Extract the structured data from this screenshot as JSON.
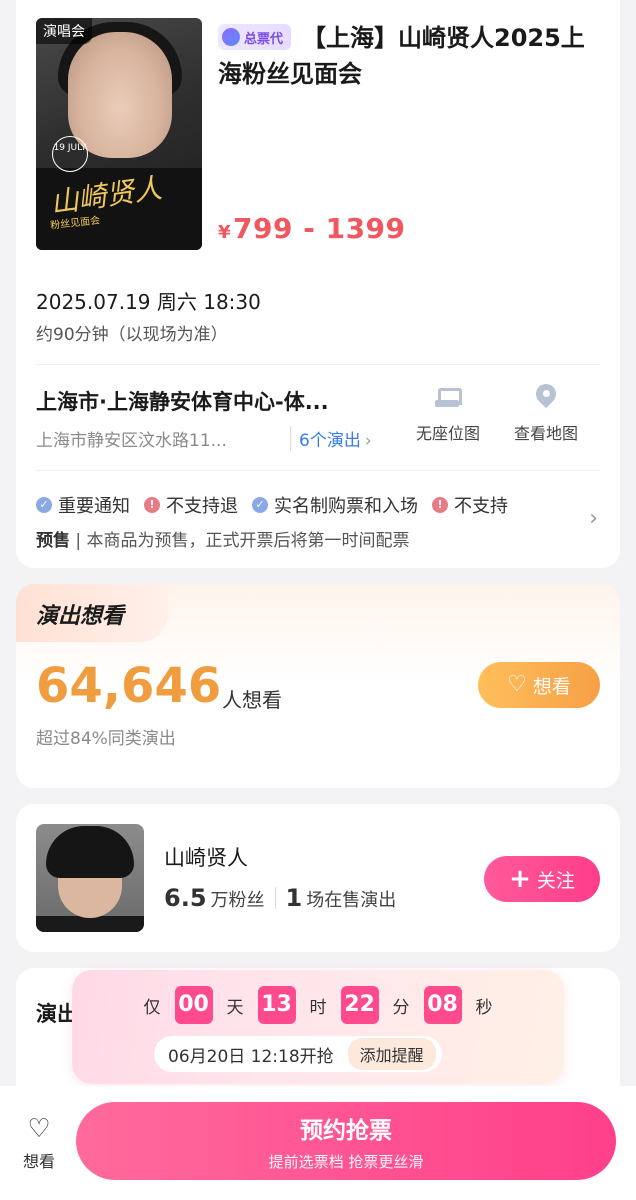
{
  "poster": {
    "tag": "演唱会",
    "date_badge": "19 JULY",
    "script": "山崎贤人",
    "sub": "粉丝见面会"
  },
  "event": {
    "agency_badge": "总票代",
    "title": "【上海】山崎贤人2025上海粉丝见面会",
    "price_symbol": "¥",
    "price_range": "799 - 1399",
    "datetime": "2025.07.19 周六 18:30",
    "duration": "约90分钟（以现场为准）",
    "venue": "上海市·上海静安体育中心-体...",
    "address": "上海市静安区汶水路11...",
    "shows_link": "6个演出",
    "actions": [
      {
        "label": "无座位图",
        "icon": "seat-map-icon"
      },
      {
        "label": "查看地图",
        "icon": "map-pin-icon"
      }
    ],
    "notices": [
      {
        "label": "重要通知",
        "type": "ok"
      },
      {
        "label": "不支持退",
        "type": "no"
      },
      {
        "label": "实名制购票和入场",
        "type": "ok"
      },
      {
        "label": "不支持",
        "type": "no"
      }
    ],
    "presale_label": "预售",
    "presale_text": "本商品为预售，正式开票后将第一时间配票"
  },
  "want": {
    "tab_label": "演出想看",
    "count": "64,646",
    "unit": "人想看",
    "sub": "超过84%同类演出",
    "button": "想看"
  },
  "artist": {
    "name": "山崎贤人",
    "fans_num": "6.5",
    "fans_unit": "万粉丝",
    "shows_num": "1",
    "shows_unit": "场在售演出",
    "follow": "关注"
  },
  "info_card": {
    "title": "演出"
  },
  "countdown": {
    "prefix": "仅",
    "days": "00",
    "days_unit": "天",
    "hours": "13",
    "hours_unit": "时",
    "minutes": "22",
    "minutes_unit": "分",
    "seconds": "08",
    "seconds_unit": "秒",
    "start_text": "06月20日 12:18开抢",
    "remind_button": "添加提醒"
  },
  "bottom": {
    "fav_label": "想看",
    "reserve_main": "预约抢票",
    "reserve_sub": "提前选票档 抢票更丝滑"
  },
  "colors": {
    "price": "#f0575f",
    "want_count": "#ef9d3e",
    "accent_pink": "#ff3f8a",
    "link_blue": "#3a7bf2"
  }
}
